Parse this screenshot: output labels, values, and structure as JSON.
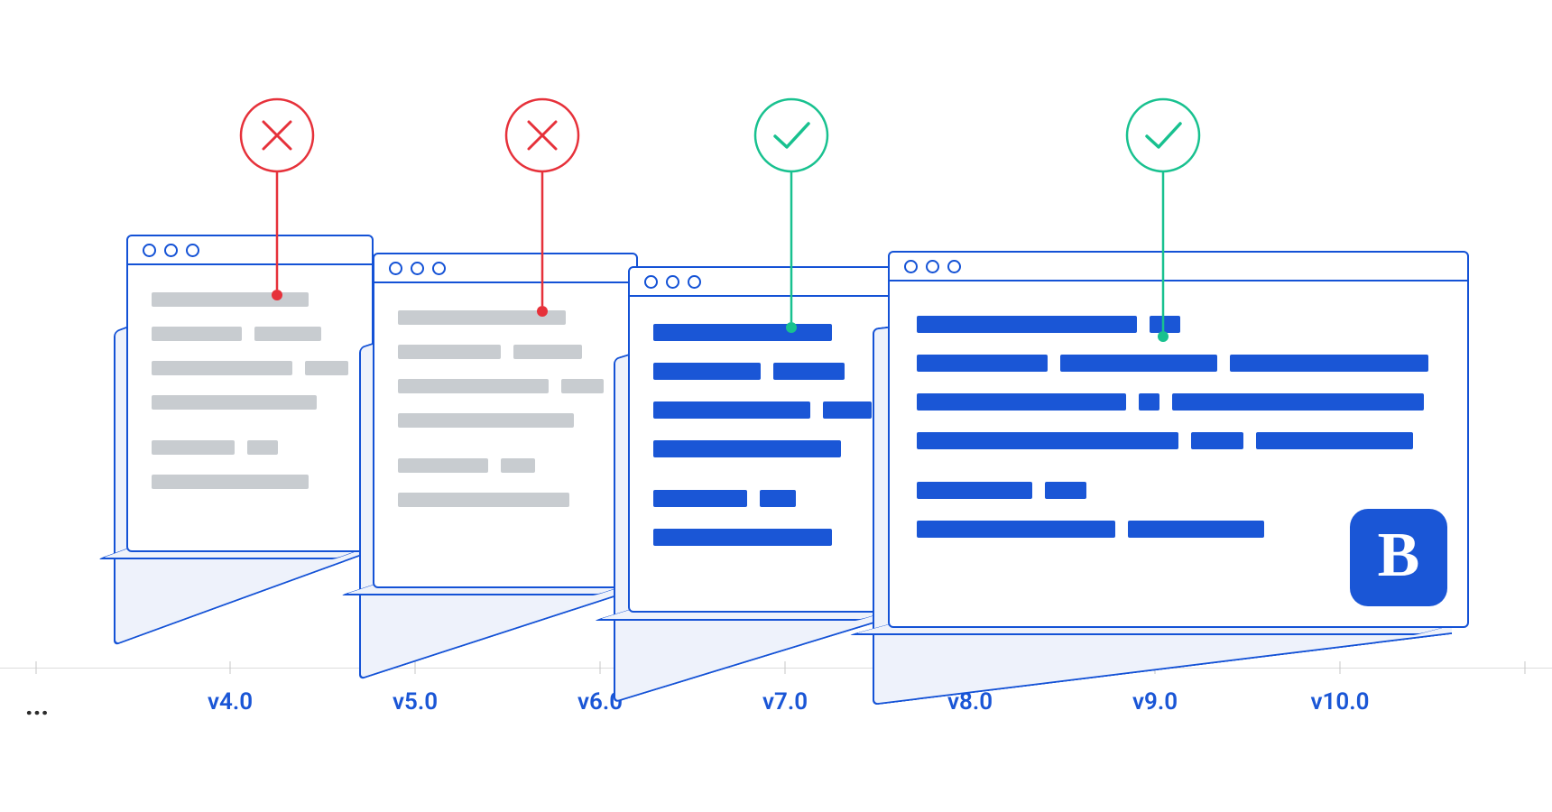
{
  "timeline": {
    "ellipsis": "...",
    "labels": [
      "v4.0",
      "v5.0",
      "v6.0",
      "v7.0",
      "v8.0",
      "v9.0",
      "v10.0"
    ]
  },
  "windows": [
    {
      "status": "fail",
      "content_style": "grey"
    },
    {
      "status": "fail",
      "content_style": "grey"
    },
    {
      "status": "success",
      "content_style": "blue"
    },
    {
      "status": "success",
      "content_style": "blue"
    }
  ],
  "badge": {
    "letter": "B"
  },
  "colors": {
    "blue": "#1a56d6",
    "grey_bar": "#c8ccd0",
    "success": "#18c18f",
    "fail": "#e6313a"
  }
}
